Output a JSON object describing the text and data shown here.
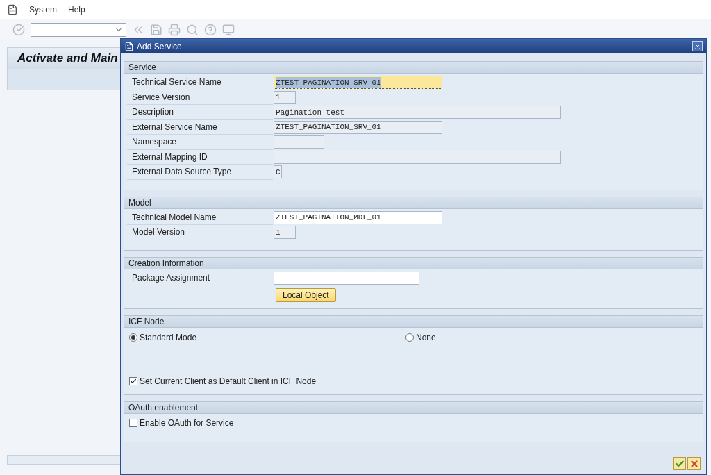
{
  "menu": [
    "System",
    "Help"
  ],
  "page_title": "Activate and Main",
  "dialog": {
    "title": "Add Service",
    "sections": [
      {
        "title": "Service",
        "fields": [
          {
            "label": "Technical Service Name",
            "value": "ZTEST_PAGINATION_SRV_01",
            "kind": "medium",
            "editable": true,
            "focused": true
          },
          {
            "label": "Service Version",
            "value": "1",
            "kind": "short",
            "editable": false,
            "focused": false
          },
          {
            "label": "Description",
            "value": "Pagination test",
            "kind": "long",
            "editable": false,
            "focused": false
          },
          {
            "label": "External Service Name",
            "value": "ZTEST_PAGINATION_SRV_01",
            "kind": "medium",
            "editable": false,
            "focused": false
          },
          {
            "label": "Namespace",
            "kind": "small",
            "editable": false,
            "focused": false
          },
          {
            "label": "External Mapping ID",
            "kind": "long",
            "editable": false,
            "focused": false
          },
          {
            "label": "External Data Source Type",
            "value": "C",
            "kind": "char",
            "editable": false,
            "focused": false
          }
        ]
      },
      {
        "title": "Model",
        "fields": [
          {
            "label": "Technical Model Name",
            "value": "ZTEST_PAGINATION_MDL_01",
            "kind": "medium",
            "editable": true,
            "focused": false
          },
          {
            "label": "Model Version",
            "value": "1",
            "kind": "short",
            "editable": false,
            "focused": false
          }
        ]
      },
      {
        "title": "Creation Information",
        "fields": [
          {
            "label": "Package Assignment",
            "kind": "package",
            "editable": true,
            "focused": false
          }
        ],
        "button": "Local Object"
      },
      {
        "title": "ICF Node",
        "radios": [
          {
            "label": "Standard Mode",
            "selected": true
          },
          {
            "label": "None",
            "selected": false
          }
        ],
        "checkboxes": [
          {
            "label": "Set Current Client as Default Client in ICF Node",
            "checked": true
          }
        ]
      },
      {
        "title": "OAuth enablement",
        "checkboxes": [
          {
            "label": "Enable OAuth for Service",
            "checked": false
          }
        ]
      }
    ]
  }
}
